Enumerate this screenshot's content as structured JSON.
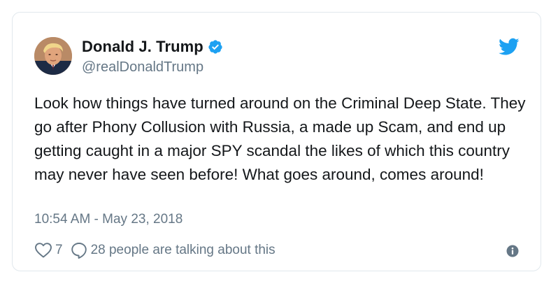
{
  "tweet": {
    "author": {
      "display_name": "Donald J. Trump",
      "handle": "@realDonaldTrump",
      "verified_icon": "verified-badge-icon",
      "avatar_icon": "profile-photo"
    },
    "text": "Look how things have turned around on the Criminal Deep State. They go after Phony Collusion with Russia, a made up Scam, and end up getting caught in a major SPY scandal the likes of which this country may never have seen before! What goes around, comes around!",
    "timestamp": "10:54 AM - May 23, 2018",
    "like_count": "7",
    "reply_text": "28 people are talking about this",
    "brand_icon": "twitter-bird-icon",
    "info_icon": "info-icon"
  },
  "colors": {
    "brand": "#1da1f2",
    "text": "#14171a",
    "secondary": "#657786",
    "border": "#e1e8ed"
  }
}
